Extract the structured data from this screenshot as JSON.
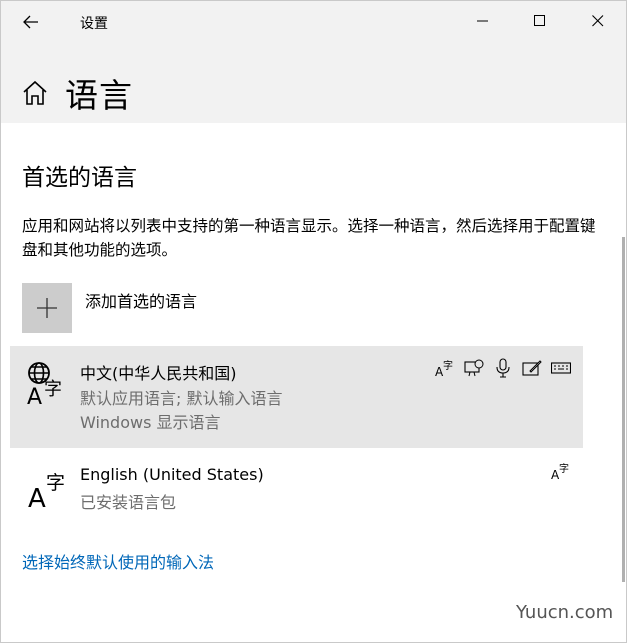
{
  "window": {
    "title": "设置"
  },
  "page": {
    "title": "语言"
  },
  "section": {
    "title": "首选的语言",
    "description": "应用和网站将以列表中支持的第一种语言显示。选择一种语言，然后选择用于配置键盘和其他功能的选项。"
  },
  "add_language": {
    "label": "添加首选的语言"
  },
  "languages": [
    {
      "name": "中文(中华人民共和国)",
      "subtitle1": "默认应用语言; 默认输入语言",
      "subtitle2": "Windows 显示语言",
      "selected": true,
      "features": [
        "language-pack-icon",
        "text-to-speech-icon",
        "speech-recognition-icon",
        "handwriting-icon",
        "keyboard-icon"
      ]
    },
    {
      "name": "English (United States)",
      "subtitle1": "已安装语言包",
      "selected": false,
      "features": [
        "language-pack-icon"
      ]
    }
  ],
  "link": {
    "label": "选择始终默认使用的输入法"
  },
  "watermark": {
    "text": "Yuucn.com"
  },
  "colors": {
    "titlebar_bg": "#f2f2f2",
    "selected_bg": "#e6e6e6",
    "add_box_bg": "#cccccc",
    "link": "#0067b8",
    "secondary_text": "#6d6d6d"
  }
}
